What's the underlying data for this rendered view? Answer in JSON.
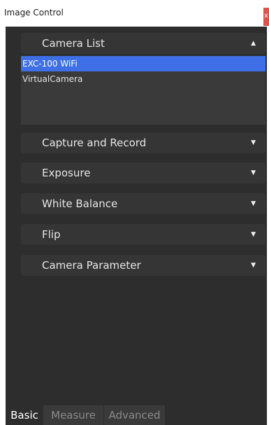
{
  "window": {
    "title": "Image Control",
    "close_label": "x"
  },
  "camera_list": {
    "header": "Camera List",
    "expanded": true,
    "items": [
      {
        "label": "EXC-100 WiFi",
        "selected": true
      },
      {
        "label": "VirtualCamera",
        "selected": false
      }
    ]
  },
  "sections": [
    {
      "label": "Capture and Record",
      "expanded": false
    },
    {
      "label": "Exposure",
      "expanded": false
    },
    {
      "label": "White Balance",
      "expanded": false
    },
    {
      "label": "Flip",
      "expanded": false
    },
    {
      "label": "Camera Parameter",
      "expanded": false
    }
  ],
  "tabs": [
    {
      "label": "Basic",
      "active": true
    },
    {
      "label": "Measure",
      "active": false
    },
    {
      "label": "Advanced",
      "active": false
    }
  ],
  "colors": {
    "panel_bg": "#2d2d2d",
    "header_bg": "#353535",
    "selection": "#3e6fe6",
    "close": "#d9534f"
  },
  "icons": {
    "expanded": "triangle-up-icon",
    "collapsed": "triangle-down-icon"
  }
}
